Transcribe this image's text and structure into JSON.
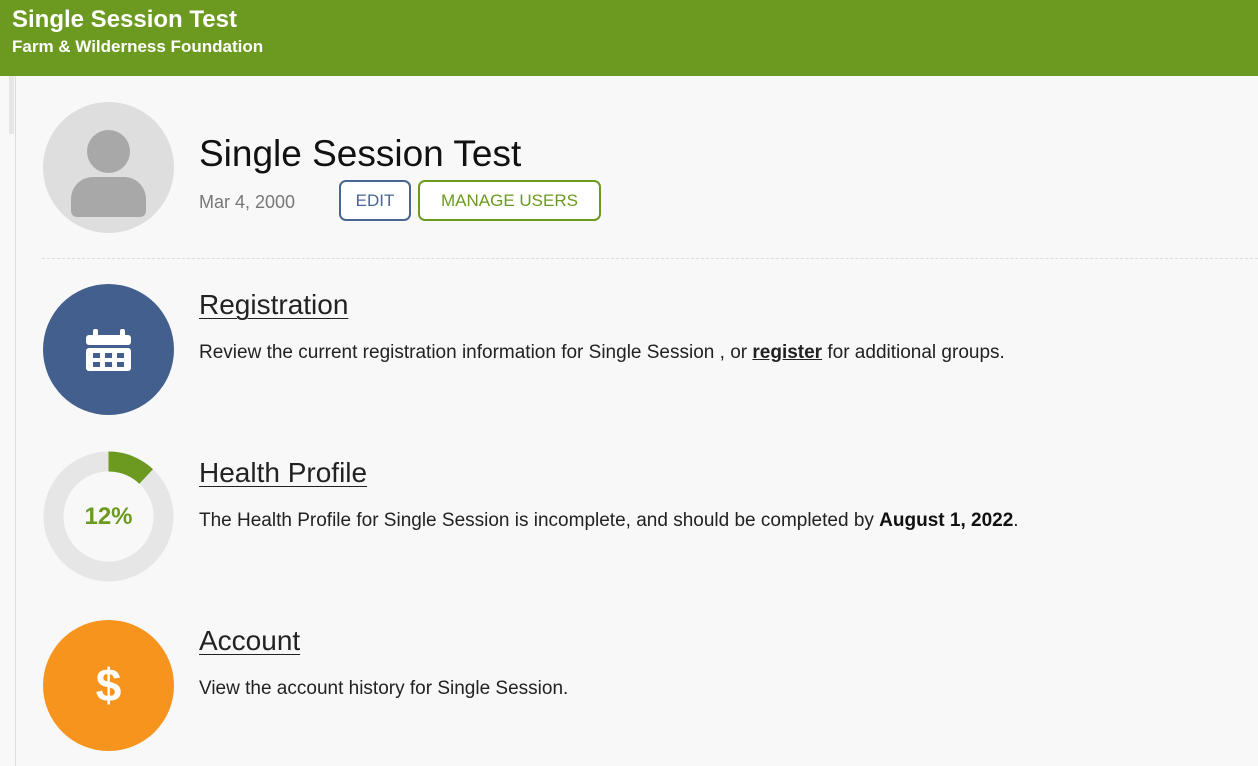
{
  "header": {
    "title": "Single Session Test",
    "subtitle": "Farm & Wilderness Foundation"
  },
  "profile": {
    "name": "Single Session Test",
    "date": "Mar 4, 2000",
    "edit_label": "EDIT",
    "manage_users_label": "MANAGE USERS"
  },
  "registration": {
    "title": "Registration",
    "desc_before": "Review the current registration information for Single Session , or ",
    "link": "register",
    "desc_after": " for additional groups.",
    "icon": "calendar-icon"
  },
  "health": {
    "title": "Health Profile",
    "desc_before": "The Health Profile for Single Session is incomplete, and should be completed by ",
    "due_date": "August 1, 2022",
    "desc_after": ".",
    "percent_label": "12%",
    "percent": 12
  },
  "account": {
    "title": "Account",
    "desc": "View the account history for Single Session.",
    "icon_glyph": "$"
  },
  "colors": {
    "brand_green": "#6c9a20",
    "registration_blue": "#435f8e",
    "account_orange": "#f7941d"
  }
}
